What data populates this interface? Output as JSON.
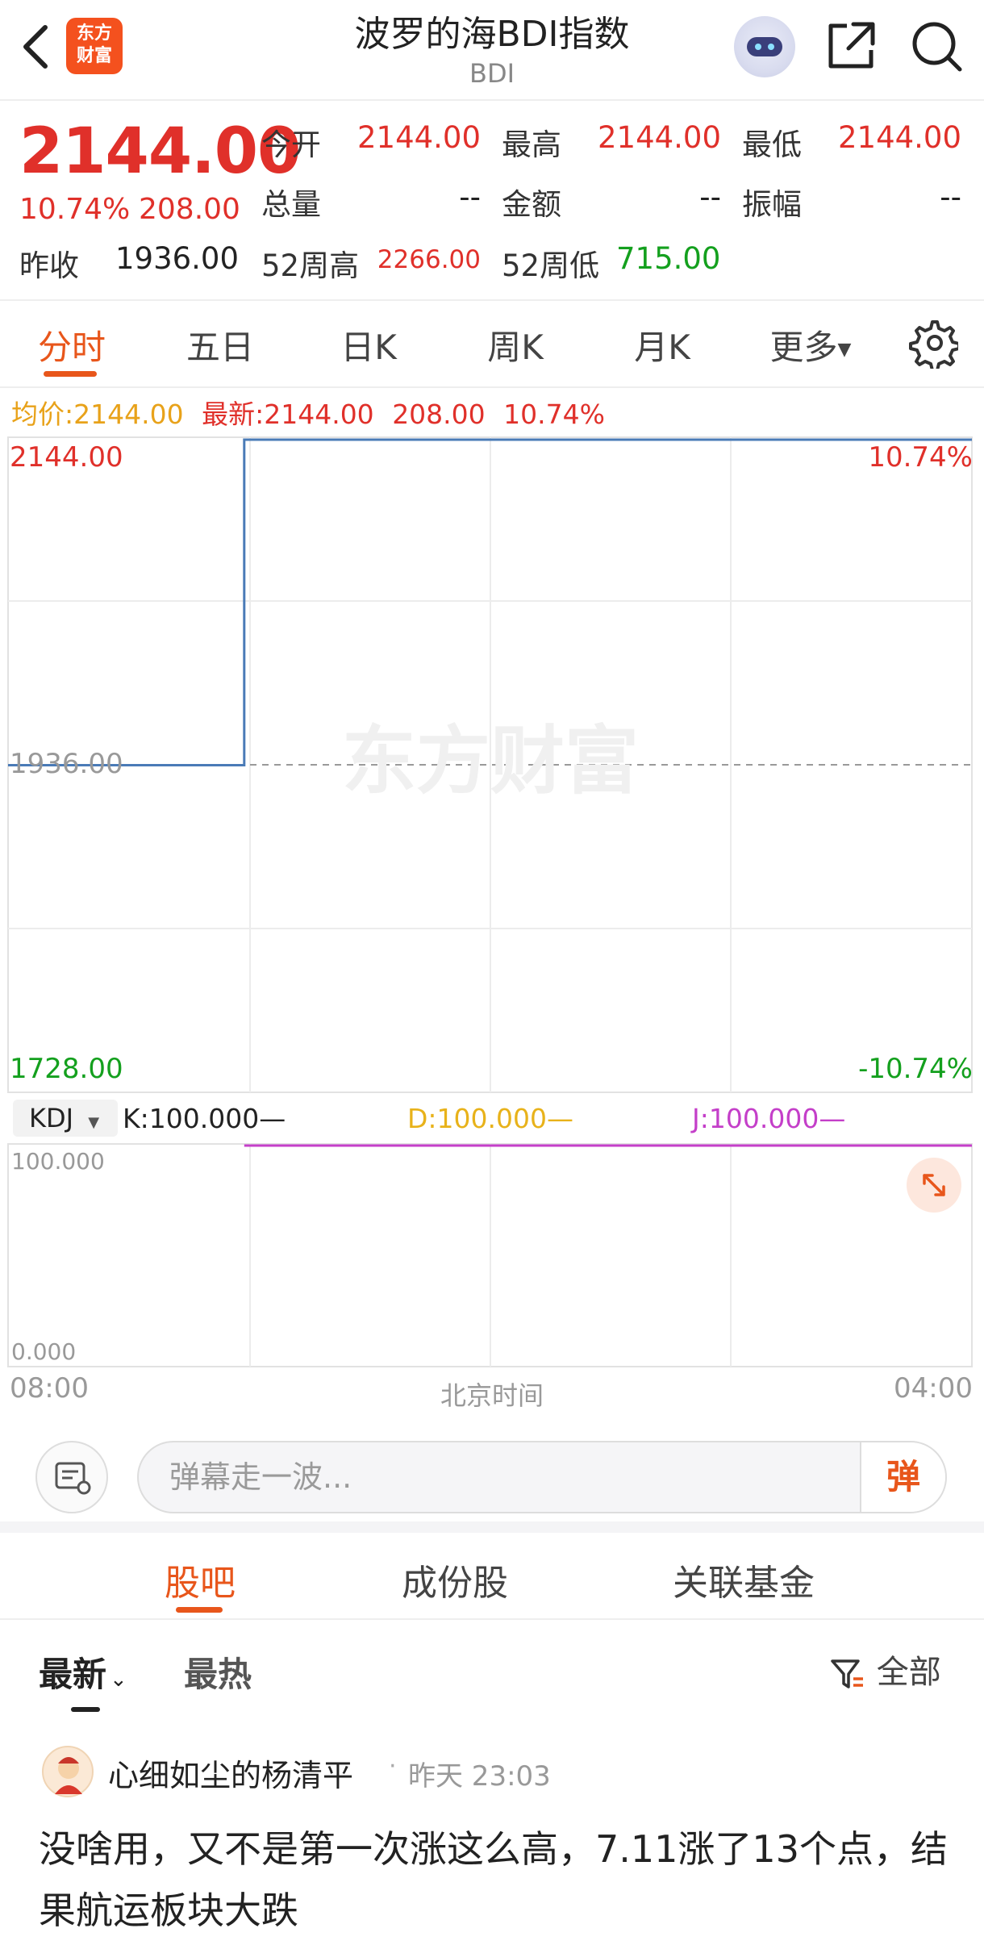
{
  "header": {
    "title": "波罗的海BDI指数",
    "subtitle": "BDI",
    "logo_text_1": "东方",
    "logo_text_2": "财富",
    "icons": [
      "back-arrow-icon",
      "robot-assistant-icon",
      "share-icon",
      "search-icon"
    ]
  },
  "quote": {
    "price": "2144.00",
    "change_pct": "10.74%",
    "change_abs": "208.00",
    "open_label": "今开",
    "open": "2144.00",
    "high_label": "最高",
    "high": "2144.00",
    "low_label": "最低",
    "low": "2144.00",
    "volume_label": "总量",
    "volume": "--",
    "amount_label": "金额",
    "amount": "--",
    "amplitude_label": "振幅",
    "amplitude": "--",
    "prev_close_label": "昨收",
    "prev_close": "1936.00",
    "w52_high_label": "52周高",
    "w52_high": "2266.00",
    "w52_low_label": "52周低",
    "w52_low": "715.00"
  },
  "tabs": [
    {
      "label": "分时",
      "active": true
    },
    {
      "label": "五日"
    },
    {
      "label": "日K"
    },
    {
      "label": "周K"
    },
    {
      "label": "月K"
    },
    {
      "label": "更多"
    }
  ],
  "info_line": {
    "avg_label": "均价:",
    "avg": "2144.00",
    "latest_label": "最新:",
    "latest": "2144.00",
    "change_abs": "208.00",
    "change_pct": "10.74%"
  },
  "chart_data": [
    {
      "type": "line",
      "ylim": [
        1728.0,
        2144.0
      ],
      "x_start": "08:00",
      "x_end": "04:00",
      "xlabel": "北京时间",
      "y_top_label": "2144.00",
      "y_mid_label": "1936.00",
      "y_bottom_label": "1728.00",
      "right_top_label": "10.74%",
      "right_bottom_label": "-10.74%",
      "reference_line": 1936.0,
      "watermark": "东方财富",
      "series": [
        {
          "values_by_fraction": [
            [
              0.0,
              1936.0
            ],
            [
              0.245,
              1936.0
            ],
            [
              0.245,
              2144.0
            ],
            [
              1.0,
              2144.0
            ]
          ],
          "color": "#4a7bb7"
        }
      ]
    },
    {
      "type": "line",
      "indicator": "KDJ",
      "ylim": [
        0.0,
        100.0
      ],
      "y_top_label": "100.000",
      "y_bottom_label": "0.000",
      "series": [
        {
          "name": "K:100.000",
          "color": "#222222",
          "values_by_fraction": [
            [
              0.245,
              100.0
            ],
            [
              1.0,
              100.0
            ]
          ]
        },
        {
          "name": "D:100.000",
          "color": "#e8b21a",
          "values_by_fraction": [
            [
              0.245,
              100.0
            ],
            [
              1.0,
              100.0
            ]
          ]
        },
        {
          "name": "J:100.000",
          "color": "#c43fc9",
          "values_by_fraction": [
            [
              0.245,
              100.0
            ],
            [
              1.0,
              100.0
            ]
          ]
        }
      ]
    }
  ],
  "danmu": {
    "placeholder": "弹幕走一波...",
    "button": "弹"
  },
  "bottom_tabs": [
    {
      "label": "股吧",
      "active": true
    },
    {
      "label": "成份股"
    },
    {
      "label": "关联基金"
    }
  ],
  "sort": {
    "latest": "最新",
    "hot": "最热",
    "filter": "全部"
  },
  "post": {
    "author": "心细如尘的杨清平",
    "dot": "·",
    "time": "昨天 23:03",
    "content": "没啥用，又不是第一次涨这么高，7.11涨了13个点，结果航运板块大跌"
  },
  "colors": {
    "up": "#e0302a",
    "down": "#14a01e",
    "accent": "#e8561b",
    "price_line": "#4a7bb7"
  }
}
